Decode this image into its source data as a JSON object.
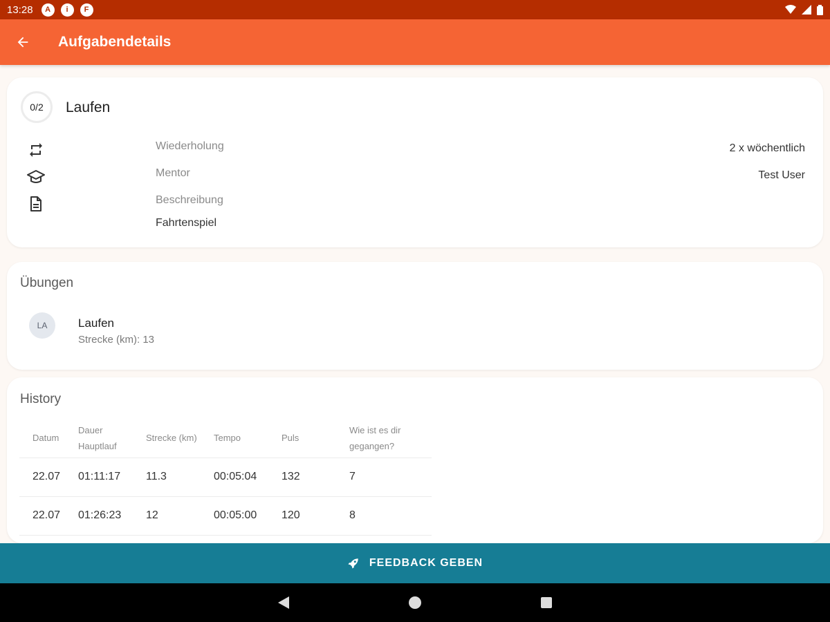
{
  "status_bar": {
    "time": "13:28",
    "notification_icons": [
      "A",
      "i",
      "F"
    ],
    "right_icons": [
      "wifi-icon",
      "signal-icon",
      "battery-icon"
    ]
  },
  "app_bar": {
    "title": "Aufgabendetails",
    "back_icon": "arrow-back-icon",
    "color": "#f56434"
  },
  "task": {
    "progress": "0/2",
    "title": "Laufen",
    "rows": [
      {
        "icon": "repeat-icon",
        "label": "Wiederholung",
        "value": "2 x wöchentlich"
      },
      {
        "icon": "school-icon",
        "label": "Mentor",
        "value": "Test User"
      },
      {
        "icon": "document-icon",
        "label": "Beschreibung",
        "value": "Fahrtenspiel"
      }
    ]
  },
  "exercises": {
    "title": "Übungen",
    "items": [
      {
        "avatar": "LA",
        "name": "Laufen",
        "detail": "Strecke (km): 13"
      }
    ]
  },
  "history": {
    "title": "History",
    "columns": [
      "Datum",
      "Dauer Hauptlauf",
      "Strecke (km)",
      "Tempo",
      "Puls",
      "Wie ist es dir gegangen?"
    ],
    "rows": [
      [
        "22.07",
        "01:11:17",
        "11.3",
        "00:05:04",
        "132",
        "7"
      ],
      [
        "22.07",
        "01:26:23",
        "12",
        "00:05:00",
        "120",
        "8"
      ]
    ]
  },
  "feedback": {
    "label": "FEEDBACK GEBEN",
    "icon": "rocket-icon",
    "color": "#167d95"
  },
  "nav_bar": {
    "buttons": [
      "back-triangle-icon",
      "home-circle-icon",
      "recents-square-icon"
    ]
  }
}
